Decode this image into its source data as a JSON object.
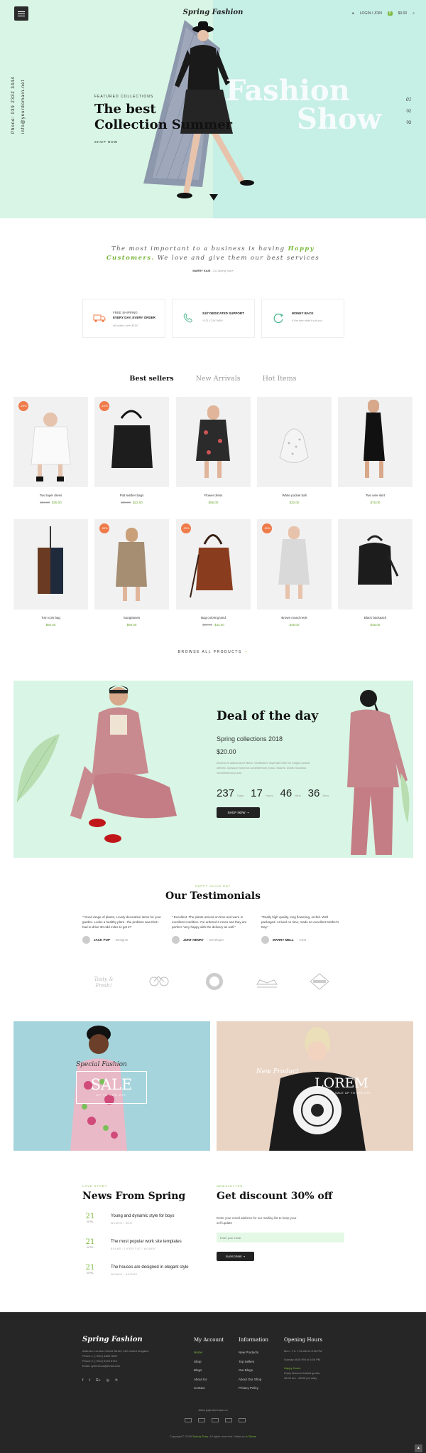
{
  "header": {
    "logo": "Spring Fashion",
    "login": "LOGIN / JOIN",
    "cart_count": "0",
    "cart_total": "$0.00"
  },
  "hero": {
    "phone": "Phone: 039 2332 3444",
    "email": "info@yourdomain.net",
    "subtitle": "FEATURED COLLECTIONS",
    "title_line1": "The best",
    "title_line2": "Collection Summer",
    "shop_now": "SHOP NOW",
    "bg_text_1": "Fashion",
    "bg_text_2": "Show",
    "slide_1": "01",
    "slide_2": "02",
    "slide_3": "03",
    "colors": {
      "left": "#d8f5e5",
      "right": "#c6efe6"
    }
  },
  "quote": {
    "line1_pre": "The most important to a business is having ",
    "line1_hl": "Happy",
    "line2_hl": "Customers.",
    "line2_post": " We love and give them our best services",
    "author": "MARRY KAIE",
    "author_role": " - Co-Spring Store"
  },
  "features": [
    {
      "icon": "truck-icon",
      "t1": "FREE SHIPPING",
      "t2": "EVERY DAY, EVERY ORDER",
      "t3": "all orders over $100"
    },
    {
      "icon": "phone-icon",
      "t1": "",
      "t2": "24/7 DEDICATED SUPPORT",
      "t3": "+111 1234 5689"
    },
    {
      "icon": "refresh-icon",
      "t1": "",
      "t2": "MONEY BACK",
      "t3": "If the item didn't suit you"
    }
  ],
  "tabs": [
    "Best sellers",
    "New Arrivals",
    "Hot Items"
  ],
  "products": [
    {
      "name": "Two layer dress",
      "old": "$32.00",
      "price": "$35.00",
      "badge": "-20%"
    },
    {
      "name": "Flat leather bags",
      "old": "$25.00",
      "price": "$22.00",
      "badge": "-10%"
    },
    {
      "name": "Flower dress",
      "old": "",
      "price": "$55.00",
      "badge": ""
    },
    {
      "name": "White pocket ball",
      "old": "",
      "price": "$32.00",
      "badge": ""
    },
    {
      "name": "Two wire skirt",
      "old": "",
      "price": "$75.00",
      "badge": ""
    },
    {
      "name": "Tom coin bag",
      "old": "",
      "price": "$50.00",
      "badge": ""
    },
    {
      "name": "Sunglasses",
      "old": "",
      "price": "$90.00",
      "badge": "-30%"
    },
    {
      "name": "Bag coloring land",
      "old": "$55.00",
      "price": "$42.00",
      "badge": "-20%"
    },
    {
      "name": "Brown round neck",
      "old": "",
      "price": "$45.00",
      "badge": "-20%"
    },
    {
      "name": "Black backpack",
      "old": "",
      "price": "$48.00",
      "badge": ""
    }
  ],
  "browse": "BROWSE ALL PRODUCTS",
  "deal": {
    "title": "Deal of the day",
    "collection": "Spring collections 2018",
    "price": "$20.00",
    "desc": "Aenean in ullamcorper libero. Vestibulum imperdiet nibh vel magna lacinia ultrices. Quisque euismod condimentum purus. Mauris. Donec faucibus condimentum purus.",
    "days": "237",
    "days_l": "Days",
    "hours": "17",
    "hours_l": "Hours",
    "mins": "46",
    "mins_l": "Mins",
    "secs": "36",
    "secs_l": "Secs",
    "button": "SHOP NOW"
  },
  "testimonials": {
    "label": "HAPPY CLICK DAY",
    "title": "Our Testimonials",
    "items": [
      {
        "text": "\" Good range of plants, Lovely decorative items for your garden. Looks a healthy plant - the problem was that I had to drive 30-odd miles to get it!\"",
        "name": "JACK POP",
        "role": " - Designer"
      },
      {
        "text": "\" Excellent. The plants arrived on time and were in excellent condition. I've ordered 3 roses and they are perfect. Very happy with the delivery as well.\"",
        "name": "JONT HENRY",
        "role": " - Developer"
      },
      {
        "text": "\"Really high quality, long flowering, orchid. Well packaged. Arrived on time, made an excellent Mother's Day\"",
        "name": "MARRY MELL",
        "role": " - CEO"
      }
    ]
  },
  "brands": [
    "Tasty & Fresh!",
    "Bicycle",
    "Brand",
    "Brand",
    "Brand"
  ],
  "banners": {
    "b1_script": "Special Fashion",
    "b1_big": "SALE",
    "b1_small": "UP TO 50% OFF",
    "b2_script": "New Product",
    "b2_big": "LOREM",
    "b2_small": "SALE UP TO 50% OFF",
    "tee": "THE OVER SUPPLY CO WORLDWIDE"
  },
  "news": {
    "label": "LOVE STORY",
    "title": "News From Spring",
    "items": [
      {
        "day": "21",
        "mon": "APRIL",
        "title": "Young and dynamic style for boys",
        "cat": "WOMEN  /  MEN"
      },
      {
        "day": "21",
        "mon": "APRIL",
        "title": "The most popular work site templates",
        "cat": "BRAND  /  LIFESTYLE  /  WOMEN"
      },
      {
        "day": "21",
        "mon": "APRIL",
        "title": "The houses are designed in elegant style",
        "cat": "WOMEN  /  NATURE"
      }
    ]
  },
  "newsletter": {
    "label": "NEWSLETTER",
    "title": "Get discount 30% off",
    "text": "Enter your email address for our mailing list to keep your self update",
    "placeholder": "Enter your email",
    "button": "SUBSCRIBE"
  },
  "footer": {
    "logo": "Spring Fashion",
    "addr1": "Address: London Oxford Street, 012 United Kingdom",
    "addr2": "Phone 1: (+012) 3456 7890",
    "addr3": "Phone 2: (+012) 9123 5744",
    "addr4": "Email: spleenroot@email.com",
    "col1": {
      "title": "My Account",
      "items": [
        "Home",
        "Shop",
        "Blogs",
        "About Us",
        "Contact"
      ]
    },
    "col2": {
      "title": "Information",
      "items": [
        "New Products",
        "Top Sellers",
        "Our Blogs",
        "About Our Shop",
        "Privacy Policy"
      ]
    },
    "col3": {
      "title": "Opening Hours",
      "l1": "Mon - Fri: 7.00 AM to 8.00 PM",
      "l2": "Sunday: 8:00 PM to 5:00 PM",
      "l3": "Happy Hours",
      "l4": "Enjoy discount baked goods,",
      "l5": "06:00 am - 08:00 pm daily"
    },
    "pay_label": "Allow payment base on",
    "copy_pre": "Copyright © 2018 ",
    "copy_brand": "Spring Shop",
    "copy_mid": ". All rights reserved. Made by ",
    "copy_author": "is Sktum"
  }
}
